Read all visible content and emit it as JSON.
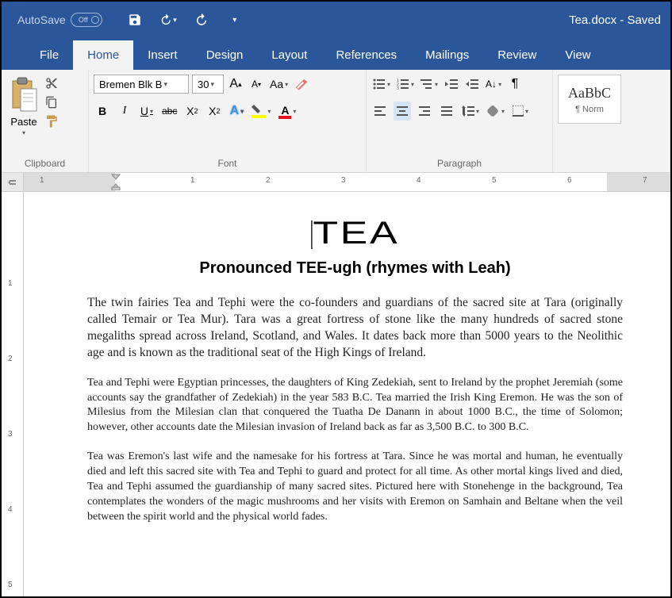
{
  "titlebar": {
    "autosave_label": "AutoSave",
    "autosave_state": "Off",
    "doc_title": "Tea.docx - Saved"
  },
  "tabs": {
    "file": "File",
    "home": "Home",
    "insert": "Insert",
    "design": "Design",
    "layout": "Layout",
    "references": "References",
    "mailings": "Mailings",
    "review": "Review",
    "view": "View"
  },
  "ribbon": {
    "clipboard": {
      "label": "Clipboard",
      "paste": "Paste"
    },
    "font": {
      "label": "Font",
      "name": "Bremen Blk B",
      "size": "30",
      "bold": "B",
      "italic": "I",
      "underline": "U",
      "strike": "abc",
      "sub": "X",
      "sup": "X"
    },
    "paragraph": {
      "label": "Paragraph"
    },
    "styles": {
      "preview": "AaBbC",
      "name": "¶ Norm"
    }
  },
  "ruler": {
    "nums_h": [
      "1",
      "1",
      "2",
      "3",
      "4",
      "5",
      "6",
      "7"
    ],
    "nums_v": [
      "1",
      "2",
      "3",
      "4",
      "5"
    ]
  },
  "document": {
    "title": "TEA",
    "subtitle": "Pronounced TEE-ugh (rhymes with Leah)",
    "p1": "The twin fairies Tea and Tephi were the co-founders and guardians of the sacred site at Tara (originally called Temair or Tea Mur). Tara was a great fortress of stone like the many hundreds of sacred stone megaliths spread across Ireland, Scotland, and Wales. It dates back more than 5000 years to the Neolithic age and is known as the traditional seat of the High Kings of Ireland.",
    "p2": "Tea and Tephi were Egyptian princesses, the daughters of King Zedekiah, sent to Ireland by the prophet Jeremiah (some accounts say the grandfather of Zedekiah) in the year 583 B.C. Tea married the Irish King Eremon. He was the son of Milesius from the Milesian clan that conquered the Tuatha De Danann in about 1000 B.C., the time of Solomon; however, other accounts date the Milesian invasion of Ireland back as far as 3,500 B.C. to 300 B.C.",
    "p3": "Tea was Eremon's last wife and the namesake for his fortress at Tara. Since he was mortal and human, he eventually died and left this sacred site with Tea and Tephi to guard and protect for all time. As other mortal kings lived and died, Tea and Tephi assumed the guardianship of many sacred sites. Pictured here with Stonehenge in the background, Tea contemplates the wonders of the magic mushrooms and her visits with Eremon on Samhain and Beltane when the veil between the spirit world and the physical world fades."
  }
}
